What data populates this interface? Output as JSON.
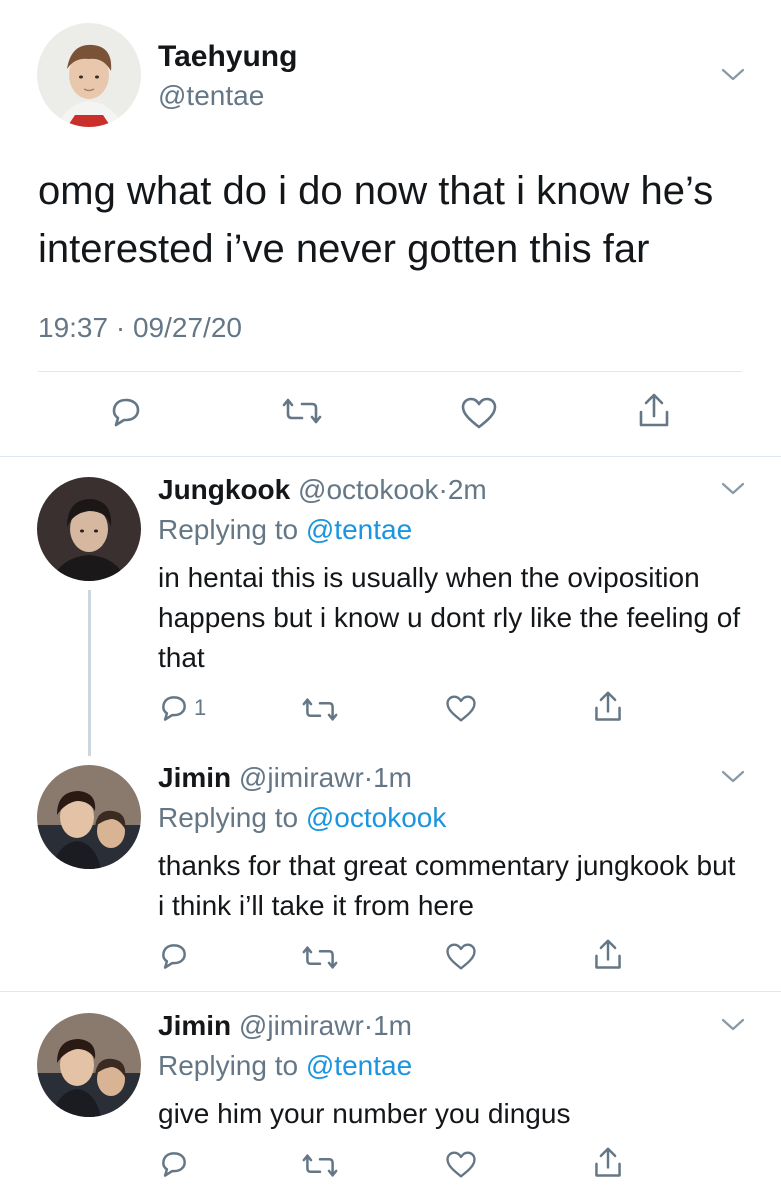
{
  "main_tweet": {
    "name": "Taehyung",
    "handle": "@tentae",
    "text": "omg what do i do now that i know he’s interested i’ve never gotten this far",
    "time": "19:37",
    "separator": "·",
    "date": "09/27/20"
  },
  "replies": [
    {
      "name": "Jungkook",
      "handle": "@octokook",
      "dot": "·",
      "time": "2m",
      "replying_prefix": "Replying to",
      "replying_to": "@tentae",
      "text": "in hentai this is usually when the oviposition happens but i know u dont rly like the feeling of that",
      "reply_count": "1"
    },
    {
      "name": "Jimin",
      "handle": "@jimirawr",
      "dot": "·",
      "time": "1m",
      "replying_prefix": "Replying to",
      "replying_to": "@octokook",
      "text": "thanks for that great commentary jungkook but i think i’ll take it from here"
    },
    {
      "name": "Jimin",
      "handle": "@jimirawr",
      "dot": "·",
      "time": "1m",
      "replying_prefix": "Replying to",
      "replying_to": "@tentae",
      "text": "give him your number you dingus"
    }
  ],
  "icons": {
    "reply": "reply-bubble-icon",
    "retweet": "retweet-icon",
    "like": "heart-icon",
    "share": "share-icon",
    "more": "chevron-down-icon"
  },
  "colors": {
    "text": "#14171a",
    "secondary": "#657786",
    "link": "#1b95e0",
    "divider": "#e1e8ed",
    "thread_line": "#ccd6dd",
    "icon": "#657786"
  }
}
